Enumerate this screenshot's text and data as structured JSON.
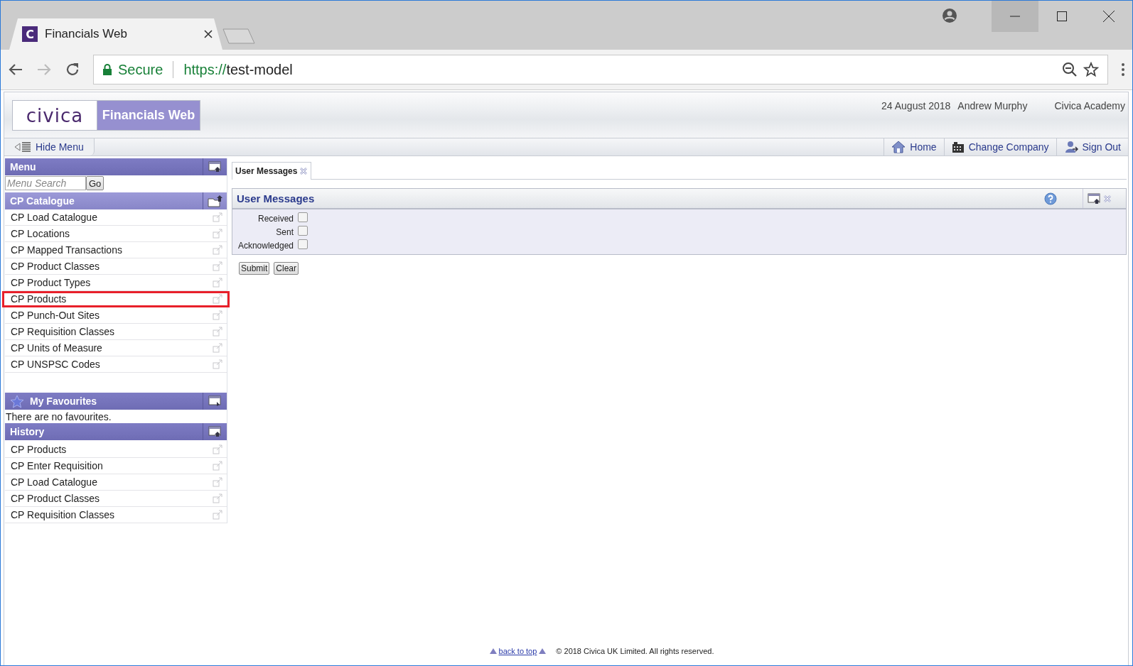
{
  "browser": {
    "tab_icon": "C",
    "tab_title": "Financials Web",
    "security": "Secure",
    "url_scheme": "https://",
    "url_host": "test-model"
  },
  "header": {
    "logo": "civica",
    "app_name": "Financials Web",
    "date": "24 August 2018",
    "user": "Andrew Murphy",
    "organisation": "Civica Academy"
  },
  "toolbar": {
    "hide_menu": "Hide Menu",
    "links": [
      {
        "label": "Home",
        "kind": "home"
      },
      {
        "label": "Change Company",
        "kind": "company"
      },
      {
        "label": "Sign Out",
        "kind": "signout"
      }
    ]
  },
  "sidebar": {
    "menu": {
      "title": "Menu",
      "search_placeholder": "Menu Search",
      "go": "Go"
    },
    "catalogue": {
      "title": "CP Catalogue",
      "items": [
        {
          "label": "CP Load Catalogue",
          "highlighted": false
        },
        {
          "label": "CP Locations",
          "highlighted": false
        },
        {
          "label": "CP Mapped Transactions",
          "highlighted": false
        },
        {
          "label": "CP Product Classes",
          "highlighted": false
        },
        {
          "label": "CP Product Types",
          "highlighted": false
        },
        {
          "label": "CP Products",
          "highlighted": true
        },
        {
          "label": "CP Punch-Out Sites",
          "highlighted": false
        },
        {
          "label": "CP Requisition Classes",
          "highlighted": false
        },
        {
          "label": "CP Units of Measure",
          "highlighted": false
        },
        {
          "label": "CP UNSPSC Codes",
          "highlighted": false
        }
      ]
    },
    "favourites": {
      "title": "My Favourites",
      "empty": "There are no favourites."
    },
    "history": {
      "title": "History",
      "items": [
        {
          "label": "CP Products"
        },
        {
          "label": "CP Enter Requisition"
        },
        {
          "label": "CP Load Catalogue"
        },
        {
          "label": "CP Product Classes"
        },
        {
          "label": "CP Requisition Classes"
        }
      ]
    }
  },
  "tabs": [
    {
      "label": "User Messages",
      "selected": true
    }
  ],
  "panel": {
    "title": "User Messages",
    "filters": [
      {
        "label": "Received",
        "checked": false
      },
      {
        "label": "Sent",
        "checked": false
      },
      {
        "label": "Acknowledged",
        "checked": false
      }
    ],
    "buttons": [
      "Submit",
      "Clear"
    ]
  },
  "footer": {
    "back_to_top": "back to top",
    "copyright": "© 2018 Civica UK Limited. All rights reserved."
  }
}
